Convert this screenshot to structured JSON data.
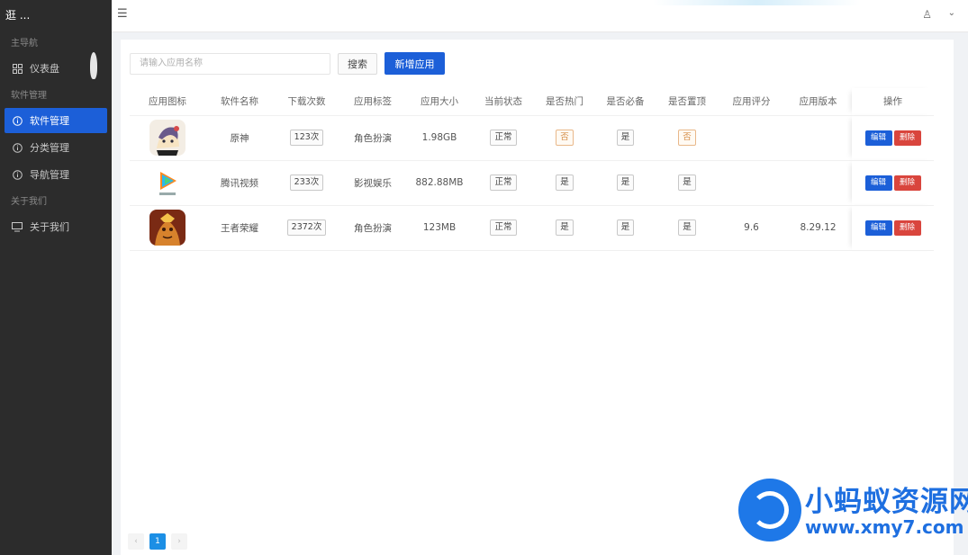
{
  "sidebar": {
    "brand": "逛 ...",
    "groups": [
      {
        "label": "主导航",
        "items": [
          {
            "label": "仪表盘",
            "icon": "grid-icon"
          }
        ]
      },
      {
        "label": "软件管理",
        "items": [
          {
            "label": "软件管理",
            "icon": "info-icon",
            "active": true
          },
          {
            "label": "分类管理",
            "icon": "info-icon"
          },
          {
            "label": "导航管理",
            "icon": "info-icon"
          }
        ]
      },
      {
        "label": "关于我们",
        "items": [
          {
            "label": "关于我们",
            "icon": "monitor-icon"
          }
        ]
      }
    ]
  },
  "topbar": {
    "menu_icon": "☰",
    "user_icon": "♙",
    "caret_icon": "⌄"
  },
  "toolbar": {
    "search_placeholder": "请输入应用名称",
    "search_label": "搜索",
    "new_label": "新增应用"
  },
  "table": {
    "headers": [
      "应用图标",
      "软件名称",
      "下载次数",
      "应用标签",
      "应用大小",
      "当前状态",
      "是否热门",
      "是否必备",
      "是否置顶",
      "应用评分",
      "应用版本",
      "操作"
    ],
    "rows": [
      {
        "icon": "genshin-icon",
        "name": "原神",
        "downloads": "123次",
        "tag": "角色扮演",
        "size": "1.98GB",
        "status": "正常",
        "hot": "否",
        "must": "是",
        "top": "否",
        "score": "",
        "version": ""
      },
      {
        "icon": "tencent-video-icon",
        "name": "腾讯视频",
        "downloads": "233次",
        "tag": "影视娱乐",
        "size": "882.88MB",
        "status": "正常",
        "hot": "是",
        "must": "是",
        "top": "是",
        "score": "",
        "version": ""
      },
      {
        "icon": "honor-of-kings-icon",
        "name": "王者荣耀",
        "downloads": "2372次",
        "tag": "角色扮演",
        "size": "123MB",
        "status": "正常",
        "hot": "是",
        "must": "是",
        "top": "是",
        "score": "9.6",
        "version": "8.29.12"
      }
    ],
    "edit_label": "编辑",
    "delete_label": "删除"
  },
  "pagination": {
    "prev": "‹",
    "current": "1",
    "next": "›"
  },
  "watermark": {
    "title": "小蚂蚁资源网",
    "url": "www.xmy7.com"
  },
  "colors": {
    "primary": "#1c5fd8",
    "danger": "#d9453d",
    "sidebar_bg": "#2c2c2c"
  }
}
